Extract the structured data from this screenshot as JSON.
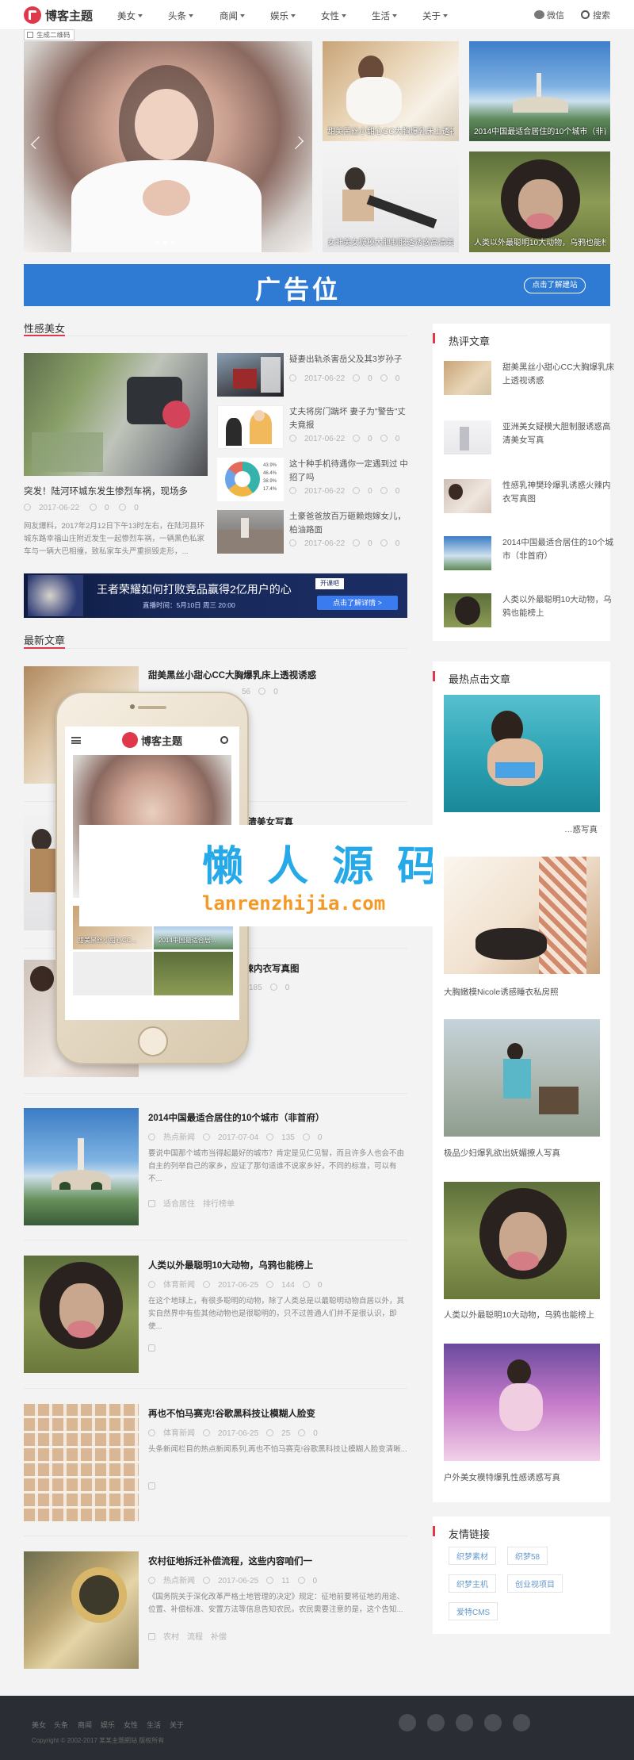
{
  "header": {
    "logo_text": "博客主题",
    "nav": [
      "美女",
      "头条",
      "商闻",
      "娱乐",
      "女性",
      "生活",
      "关于"
    ],
    "wechat": "微信",
    "search": "搜索",
    "qr_button": "生成二维码"
  },
  "slider": {
    "thumbs": [
      "甜美黑丝小甜心CC大胸爆乳床上透视诱惑",
      "2014中国最适合居住的10个城市（非首府）",
      "女神美女疑模大胆制服透诱惑高清美女写真",
      "人类以外最聪明10大动物，乌鸦也能榜上"
    ]
  },
  "banner": {
    "text": "广告位",
    "button": "点击了解建站"
  },
  "sexy": {
    "title": "性感美女",
    "feature_title": "突发！陆河环城东发生惨烈车祸，现场多",
    "feature_date": "2017-06-22",
    "feature_views": "0",
    "feature_comments": "0",
    "feature_excerpt": "网友爆料，2017年2月12日下午13时左右，在陆河县环城东路幸福山庄附近发生一起惨烈车祸，一辆黑色私家车与一辆大巴相撞，致私家车头严重损毁走形，...",
    "items": [
      {
        "title": "疑妻出轨杀害岳父及其3岁孙子",
        "date": "2017-06-22",
        "views": "0",
        "comments": "0"
      },
      {
        "title": "丈夫将房门踹坏 妻子为\"警告\"丈夫竟报",
        "date": "2017-06-22",
        "views": "0",
        "comments": "0"
      },
      {
        "title": "这十种手机待遇你一定遇到过 中招了吗",
        "date": "2017-06-22",
        "views": "0",
        "comments": "0"
      },
      {
        "title": "土豪爸爸放百万砸赖炮嫁女儿，柏油路面",
        "date": "2017-06-22",
        "views": "0",
        "comments": "0"
      }
    ],
    "pie_labels": [
      "43.9%",
      "46.4%",
      "38.9%",
      "17.4%"
    ]
  },
  "ad2": {
    "text": "王者荣耀如何打败竞品赢得2亿用户的心",
    "sub": "直播时间：5月10日 周三 20:00",
    "button": "点击了解详情 >",
    "brand": "开课吧"
  },
  "latest": {
    "title": "最新文章",
    "articles": [
      {
        "title": "甜美黑丝小甜心CC大胸爆乳床上透视诱惑",
        "cat": "",
        "date": "2017-06-22",
        "views": "56",
        "comments": "0",
        "excerpt": "",
        "tags": []
      },
      {
        "title": "…姿高清美女写真",
        "cat": "",
        "date": "",
        "views": "",
        "comments": "",
        "excerpt": "",
        "tags": []
      },
      {
        "title": "…辣内衣写真图",
        "cat": "",
        "date": "",
        "views": "185",
        "comments": "0",
        "excerpt": "",
        "tags": []
      },
      {
        "title": "2014中国最适合居住的10个城市（非首府）",
        "cat": "热点新闻",
        "date": "2017-07-04",
        "views": "135",
        "comments": "0",
        "excerpt": "要说中国那个城市当得起最好的城市？肯定是见仁见智，而且许多人也会不由自主的列举自己的家乡，应证了那句适谁不说家乡好，不同的标准，可以有不...",
        "tags": [
          "适合居住",
          "排行榜单"
        ]
      },
      {
        "title": "人类以外最聪明10大动物，乌鸦也能榜上",
        "cat": "体育新闻",
        "date": "2017-06-25",
        "views": "144",
        "comments": "0",
        "excerpt": "在这个地球上，有很多聪明的动物，除了人类总是以最聪明动物自居以外，其实自然界中有些其他动物也是很聪明的，只不过普通人们并不是很认识，即使...",
        "tags": []
      },
      {
        "title": "再也不怕马赛克!谷歌黑科技让模糊人脸变",
        "cat": "体育新闻",
        "date": "2017-06-25",
        "views": "25",
        "comments": "0",
        "excerpt": "头条新闻栏目的热点新闻系列,再也不怕马赛克!谷歌黑科技让模糊人脸变清晰...",
        "tags": []
      },
      {
        "title": "农村征地拆迁补偿流程，这些内容咱们一",
        "cat": "热点新闻",
        "date": "2017-06-25",
        "views": "11",
        "comments": "0",
        "excerpt": "《国务院关于深化改革严格土地管理的决定》规定：征地前要将征地的用途、位置、补偿标准、安置方法等信息告知农民。农民需要注意的是，这个告知...",
        "tags": [
          "农村",
          "流程",
          "补偿"
        ]
      }
    ]
  },
  "phone": {
    "logo_text": "博客主题",
    "thumb_caps": [
      "甜美黑丝小甜心CC...",
      "2014中国最适合居..."
    ]
  },
  "watermark": {
    "title": "懒 人 源 码",
    "url": "lanrenzhijia.com"
  },
  "sidebar": {
    "hot_title": "热评文章",
    "hot_items": [
      "甜美黑丝小甜心CC大胸爆乳床上透视诱惑",
      "亚洲美女疑模大胆制服诱惑高清美女写真",
      "性感乳神樊玲爆乳诱惑火辣内衣写真图",
      "2014中国最适合居住的10个城市（非首府）",
      "人类以外最聪明10大动物，乌鸦也能榜上"
    ],
    "click_title": "最热点击文章",
    "click_items": [
      "…惑写真",
      "大胸嫩模Nicole诱感睡衣私房照",
      "极品少妇爆乳欲出妩媚撩人写真",
      "人类以外最聪明10大动物，乌鸦也能榜上",
      "户外美女模特爆乳性感诱惑写真"
    ],
    "links_title": "友情链接",
    "links": [
      "织梦素材",
      "织梦58",
      "织梦主机",
      "创业视项目",
      "爱特CMS"
    ]
  },
  "footer": {
    "links": [
      "美女",
      "头条",
      "商闻",
      "娱乐",
      "女性",
      "生活",
      "关于"
    ],
    "copyright": "Copyright © 2002-2017 某某主题網站 版权所有"
  },
  "colors": {
    "accent": "#e0384b",
    "banner_blue": "#2f7bd3",
    "footer_bg": "#2a2d33",
    "link_blue": "#6699cc"
  }
}
